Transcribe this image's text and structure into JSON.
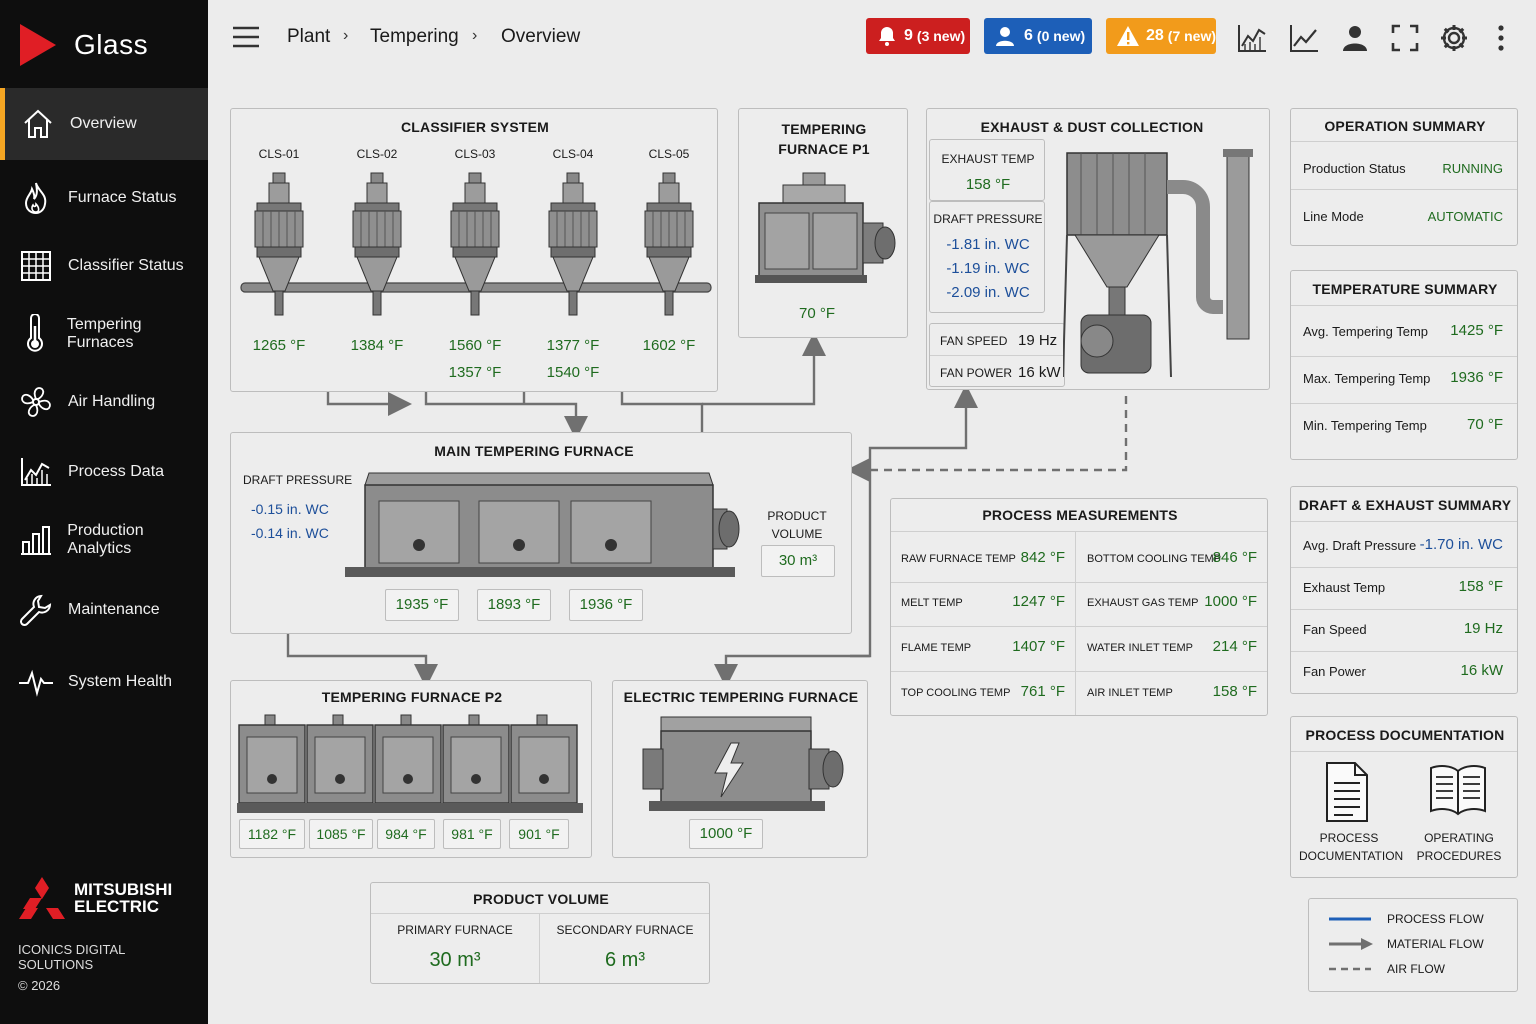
{
  "app": {
    "name": "Glass"
  },
  "sidebar": {
    "items": [
      {
        "label": "Overview",
        "icon": "home-icon"
      },
      {
        "label": "Furnace Status",
        "icon": "flame-icon"
      },
      {
        "label": "Classifier Status",
        "icon": "grid-icon"
      },
      {
        "label": "Tempering Furnaces",
        "icon": "thermometer-icon"
      },
      {
        "label": "Air Handling",
        "icon": "fan-icon"
      },
      {
        "label": "Process Data",
        "icon": "line-chart-icon"
      },
      {
        "label": "Production Analytics",
        "icon": "bar-chart-icon"
      },
      {
        "label": "Maintenance",
        "icon": "wrench-icon"
      },
      {
        "label": "System Health",
        "icon": "pulse-icon"
      }
    ],
    "footer": {
      "company_line1": "MITSUBISHI",
      "company_line2": "ELECTRIC",
      "division": "ICONICS DIGITAL SOLUTIONS",
      "copyright": "© 2026"
    }
  },
  "header": {
    "breadcrumb": [
      "Plant",
      "Tempering",
      "Overview"
    ],
    "alarms": {
      "count": "9",
      "new": "(3 new)",
      "color": "#cc1f1f"
    },
    "users": {
      "count": "6",
      "new": "(0 new)",
      "color": "#1d5fb8"
    },
    "warnings": {
      "count": "28",
      "new": "(7 new)",
      "color": "#f29b1b"
    }
  },
  "classifier": {
    "title": "CLASSIFIER SYSTEM",
    "units": [
      {
        "id": "CLS-01",
        "temp1": "1265 °F",
        "temp2": ""
      },
      {
        "id": "CLS-02",
        "temp1": "1384 °F",
        "temp2": ""
      },
      {
        "id": "CLS-03",
        "temp1": "1560 °F",
        "temp2": "1357 °F"
      },
      {
        "id": "CLS-04",
        "temp1": "1377 °F",
        "temp2": "1540 °F"
      },
      {
        "id": "CLS-05",
        "temp1": "1602 °F",
        "temp2": ""
      }
    ]
  },
  "furnace_p1": {
    "title_line1": "TEMPERING",
    "title_line2": "FURNACE P1",
    "temp": "70 °F"
  },
  "exhaust": {
    "title": "EXHAUST & DUST COLLECTION",
    "exhaust_temp_label": "EXHAUST TEMP",
    "exhaust_temp": "158 °F",
    "draft_label": "DRAFT PRESSURE",
    "draft_values": [
      "-1.81 in. WC",
      "-1.19 in. WC",
      "-2.09 in. WC"
    ],
    "fan_speed_label": "FAN SPEED",
    "fan_speed": "19 Hz",
    "fan_power_label": "FAN POWER",
    "fan_power": "16 kW"
  },
  "main_furnace": {
    "title": "MAIN TEMPERING FURNACE",
    "draft_label": "DRAFT PRESSURE",
    "draft_values": [
      "-0.15 in. WC",
      "-0.14 in. WC"
    ],
    "volume_label_line1": "PRODUCT",
    "volume_label_line2": "VOLUME",
    "volume": "30 m³",
    "temps": [
      "1935 °F",
      "1893 °F",
      "1936 °F"
    ]
  },
  "furnace_p2": {
    "title": "TEMPERING FURNACE P2",
    "temps": [
      "1182 °F",
      "1085 °F",
      "984 °F",
      "981 °F",
      "901 °F"
    ]
  },
  "electric_furnace": {
    "title": "ELECTRIC TEMPERING FURNACE",
    "temp": "1000 °F"
  },
  "process_measurements": {
    "title": "PROCESS MEASUREMENTS",
    "left": [
      {
        "label": "RAW FURNACE TEMP",
        "value": "842 °F"
      },
      {
        "label": "MELT TEMP",
        "value": "1247 °F"
      },
      {
        "label": "FLAME TEMP",
        "value": "1407 °F"
      },
      {
        "label": "TOP COOLING TEMP",
        "value": "761 °F"
      }
    ],
    "right": [
      {
        "label": "BOTTOM COOLING TEMP",
        "value": "846 °F"
      },
      {
        "label": "EXHAUST GAS TEMP",
        "value": "1000 °F"
      },
      {
        "label": "WATER INLET TEMP",
        "value": "214 °F"
      },
      {
        "label": "AIR INLET TEMP",
        "value": "158 °F"
      }
    ]
  },
  "product_volume": {
    "title": "PRODUCT VOLUME",
    "primary_label": "PRIMARY FURNACE",
    "primary_value": "30 m³",
    "secondary_label": "SECONDARY FURNACE",
    "secondary_value": "6 m³"
  },
  "operation_summary": {
    "title": "OPERATION SUMMARY",
    "rows": [
      {
        "label": "Production Status",
        "value": "RUNNING"
      },
      {
        "label": "Line Mode",
        "value": "AUTOMATIC"
      }
    ]
  },
  "temperature_summary": {
    "title": "TEMPERATURE SUMMARY",
    "rows": [
      {
        "label": "Avg. Tempering Temp",
        "value": "1425 °F"
      },
      {
        "label": "Max. Tempering Temp",
        "value": "1936 °F"
      },
      {
        "label": "Min. Tempering Temp",
        "value": "70 °F"
      }
    ]
  },
  "draft_summary": {
    "title": "DRAFT & EXHAUST SUMMARY",
    "rows": [
      {
        "label": "Avg. Draft Pressure",
        "value": "-1.70 in. WC"
      },
      {
        "label": "Exhaust Temp",
        "value": "158 °F"
      },
      {
        "label": "Fan Speed",
        "value": "19 Hz"
      },
      {
        "label": "Fan Power",
        "value": "16 kW"
      }
    ]
  },
  "documentation": {
    "title": "PROCESS DOCUMENTATION",
    "doc1_line1": "PROCESS",
    "doc1_line2": "DOCUMENTATION",
    "doc2_line1": "OPERATING",
    "doc2_line2": "PROCEDURES"
  },
  "legend": {
    "process_flow": "PROCESS FLOW",
    "material_flow": "MATERIAL FLOW",
    "air_flow": "AIR FLOW",
    "process_flow_color": "#1d5fb8"
  }
}
